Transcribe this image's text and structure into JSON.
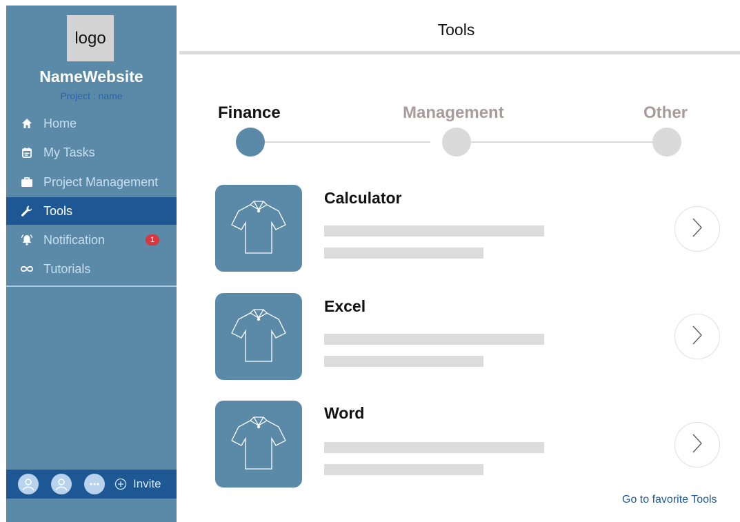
{
  "sidebar": {
    "logo_text": "logo",
    "site_name": "NameWebsite",
    "project_name": "Project : name",
    "items": [
      {
        "label": "Home",
        "icon": "home-icon"
      },
      {
        "label": "My Tasks",
        "icon": "calendar-icon"
      },
      {
        "label": "Project Management",
        "icon": "briefcase-icon"
      },
      {
        "label": "Tools",
        "icon": "wrench-icon",
        "active": true
      },
      {
        "label": "Notification",
        "icon": "bell-icon",
        "badge": "1"
      },
      {
        "label": "Tutorials",
        "icon": "infinity-icon"
      }
    ],
    "footer": {
      "avatars": [
        "user-avatar-icon",
        "user-avatar-icon",
        "more-avatars-icon"
      ],
      "invite_label": "Invite"
    }
  },
  "header": {
    "title": "Tools"
  },
  "steps": [
    {
      "label": "Finance",
      "active": true
    },
    {
      "label": "Management",
      "active": false
    },
    {
      "label": "Other",
      "active": false
    }
  ],
  "tools": [
    {
      "name": "Calculator",
      "icon": "shirt-icon"
    },
    {
      "name": "Excel",
      "icon": "shirt-icon"
    },
    {
      "name": "Word",
      "icon": "shirt-icon"
    }
  ],
  "footer_link": "Go to favorite Tools",
  "colors": {
    "sidebar_bg": "#5a8aa8",
    "active_bg": "#1e5894",
    "step_inactive_text": "#a89b9b",
    "badge": "#d9363e"
  }
}
